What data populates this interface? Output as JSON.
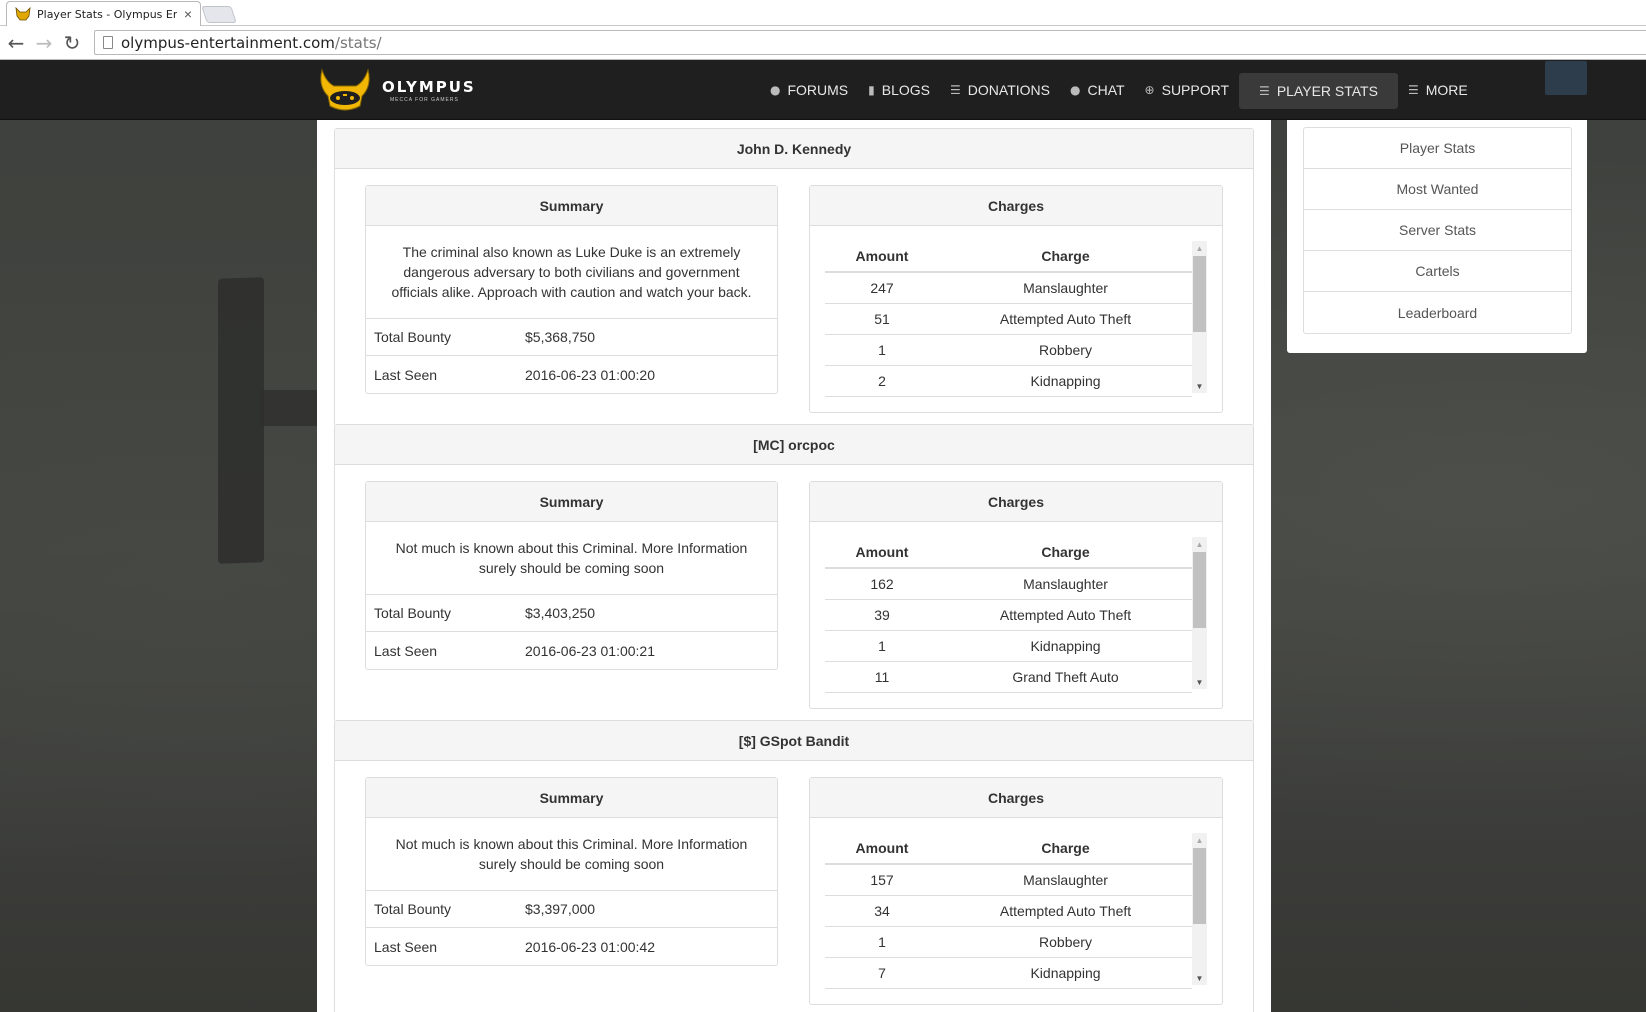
{
  "browser": {
    "tab_title": "Player Stats - Olympus Ent",
    "tab_close": "×",
    "url_host": "olympus-entertainment.com",
    "url_path": "/stats/",
    "back": "←",
    "forward": "→",
    "reload": "↻"
  },
  "site": {
    "brand_name": "OLYMPUS",
    "brand_tagline": "MECCA FOR GAMERS",
    "menu": [
      {
        "label": "FORUMS",
        "icon": "chat-bubbles-icon",
        "glyph": "💬"
      },
      {
        "label": "BLOGS",
        "icon": "book-icon",
        "glyph": "▮"
      },
      {
        "label": "DONATIONS",
        "icon": "list-icon",
        "glyph": "☰"
      },
      {
        "label": "CHAT",
        "icon": "chat-bubble-icon",
        "glyph": "💬"
      },
      {
        "label": "SUPPORT",
        "icon": "lifebuoy-icon",
        "glyph": "⊕"
      },
      {
        "label": "PLAYER STATS",
        "icon": "list-icon",
        "glyph": "☰"
      },
      {
        "label": "MORE",
        "icon": "list-icon",
        "glyph": "☰"
      }
    ],
    "colors": {
      "navbar": "#1f1f1f",
      "accent": "#f2b705",
      "active_menu": "#3a3a3a"
    }
  },
  "sidebar": {
    "items": [
      "Player Stats",
      "Most Wanted",
      "Server Stats",
      "Cartels",
      "Leaderboard"
    ]
  },
  "criminals": [
    {
      "name": "John D. Kennedy",
      "summary_heading": "Summary",
      "summary_text": "The criminal also known as Luke Duke is an extremely dangerous adversary to both civilians and government officials alike. Approach with caution and watch your back.",
      "bounty_label": "Total Bounty",
      "bounty": "$5,368,750",
      "seen_label": "Last Seen",
      "last_seen": "2016-06-23 01:00:20",
      "charges_heading": "Charges",
      "col_amount": "Amount",
      "col_charge": "Charge",
      "charges": [
        {
          "amount": "247",
          "charge": "Manslaughter"
        },
        {
          "amount": "51",
          "charge": "Attempted Auto Theft"
        },
        {
          "amount": "1",
          "charge": "Robbery"
        },
        {
          "amount": "2",
          "charge": "Kidnapping"
        }
      ]
    },
    {
      "name": "[MC] orcpoc",
      "summary_heading": "Summary",
      "summary_text": "Not much is known about this Criminal. More Information surely should be coming soon",
      "bounty_label": "Total Bounty",
      "bounty": "$3,403,250",
      "seen_label": "Last Seen",
      "last_seen": "2016-06-23 01:00:21",
      "charges_heading": "Charges",
      "col_amount": "Amount",
      "col_charge": "Charge",
      "charges": [
        {
          "amount": "162",
          "charge": "Manslaughter"
        },
        {
          "amount": "39",
          "charge": "Attempted Auto Theft"
        },
        {
          "amount": "1",
          "charge": "Kidnapping"
        },
        {
          "amount": "11",
          "charge": "Grand Theft Auto"
        }
      ]
    },
    {
      "name": "[$] GSpot Bandit",
      "summary_heading": "Summary",
      "summary_text": "Not much is known about this Criminal. More Information surely should be coming soon",
      "bounty_label": "Total Bounty",
      "bounty": "$3,397,000",
      "seen_label": "Last Seen",
      "last_seen": "2016-06-23 01:00:42",
      "charges_heading": "Charges",
      "col_amount": "Amount",
      "col_charge": "Charge",
      "charges": [
        {
          "amount": "157",
          "charge": "Manslaughter"
        },
        {
          "amount": "34",
          "charge": "Attempted Auto Theft"
        },
        {
          "amount": "1",
          "charge": "Robbery"
        },
        {
          "amount": "7",
          "charge": "Kidnapping"
        }
      ]
    }
  ]
}
